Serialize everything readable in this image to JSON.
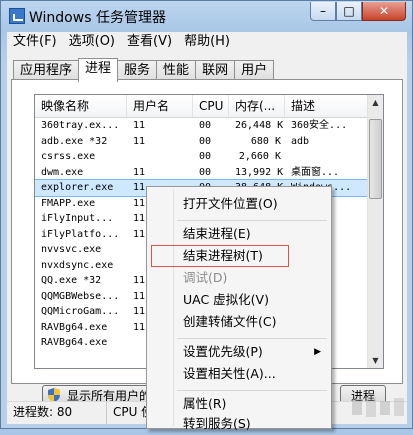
{
  "window": {
    "title": "Windows 任务管理器",
    "minimize": "–",
    "maximize": "□",
    "close": "✕"
  },
  "menu": [
    "文件(F)",
    "选项(O)",
    "查看(V)",
    "帮助(H)"
  ],
  "tabs": [
    "应用程序",
    "进程",
    "服务",
    "性能",
    "联网",
    "用户"
  ],
  "active_tab": "进程",
  "columns": [
    "映像名称",
    "用户名",
    "CPU",
    "内存(...",
    "描述"
  ],
  "rows": [
    [
      "360tray.ex...",
      "11",
      "00",
      "26,448 K",
      "360安全..."
    ],
    [
      "adb.exe *32",
      "11",
      "00",
      "680 K",
      "adb"
    ],
    [
      "csrss.exe",
      "",
      "00",
      "2,660 K",
      ""
    ],
    [
      "dwm.exe",
      "11",
      "00",
      "13,992 K",
      "桌面窗..."
    ],
    [
      "explorer.exe",
      "11",
      "00",
      "38,648 K",
      "Windows..."
    ],
    [
      "FMAPP.exe",
      "11",
      "",
      "",
      ""
    ],
    [
      "iFlyInput...",
      "11",
      "",
      "",
      ""
    ],
    [
      "iFlyPlatfo...",
      "11",
      "",
      "",
      ""
    ],
    [
      "nvvsvc.exe",
      "",
      "",
      "",
      ""
    ],
    [
      "nvxdsync.exe",
      "",
      "",
      "",
      ""
    ],
    [
      "QQ.exe *32",
      "11",
      "",
      "",
      ""
    ],
    [
      "QQMGBWebse...",
      "11",
      "",
      "",
      ""
    ],
    [
      "QQMicroGam...",
      "11",
      "",
      "",
      ""
    ],
    [
      "RAVBg64.exe",
      "11",
      "",
      "",
      ""
    ],
    [
      "RAVBg64.exe",
      "",
      "",
      "",
      ""
    ]
  ],
  "selected_row": 4,
  "show_all_button": "显示所有用户的进程",
  "end_process_button": "进程",
  "status": {
    "processes": "进程数: 80",
    "cpu": "CPU 使"
  },
  "context_menu": [
    {
      "label": "打开文件位置(O)",
      "disabled": false
    },
    {
      "label": "结束进程(E)",
      "disabled": false
    },
    {
      "label": "结束进程树(T)",
      "disabled": false
    },
    {
      "label": "调试(D)",
      "disabled": true
    },
    {
      "label": "UAC 虚拟化(V)",
      "disabled": false
    },
    {
      "label": "创建转储文件(C)",
      "disabled": false
    },
    {
      "label": "设置优先级(P)",
      "disabled": false,
      "submenu": true
    },
    {
      "label": "设置相关性(A)...",
      "disabled": false
    },
    {
      "label": "属性(R)",
      "disabled": false
    },
    {
      "label": "转到服务(S)",
      "disabled": false
    }
  ],
  "highlighted_item": "结束进程树(T)",
  "colors": {
    "highlight_box": "#d9534f",
    "selection": "#cde8ff"
  }
}
